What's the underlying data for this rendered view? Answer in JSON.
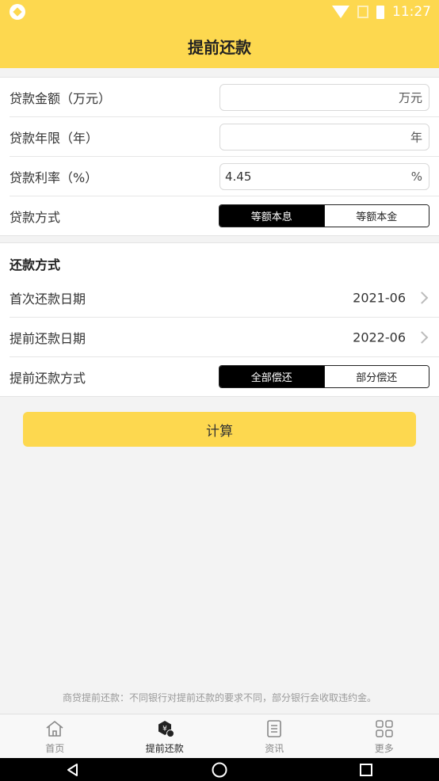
{
  "status": {
    "time": "11:27"
  },
  "header": {
    "title": "提前还款"
  },
  "loan": {
    "amount_label": "贷款金额（万元）",
    "amount_value": "",
    "amount_unit": "万元",
    "years_label": "贷款年限（年）",
    "years_value": "",
    "years_unit": "年",
    "rate_label": "贷款利率（%）",
    "rate_value": "4.45",
    "rate_unit": "%",
    "method_label": "贷款方式",
    "method_options": [
      "等额本息",
      "等额本金"
    ],
    "method_selected": "等额本息"
  },
  "repay": {
    "section_title": "还款方式",
    "first_date_label": "首次还款日期",
    "first_date_value": "2021-06",
    "prepay_date_label": "提前还款日期",
    "prepay_date_value": "2022-06",
    "prepay_method_label": "提前还款方式",
    "prepay_method_options": [
      "全部偿还",
      "部分偿还"
    ],
    "prepay_method_selected": "全部偿还"
  },
  "calculate_label": "计算",
  "footer_note": "商贷提前还款：不同银行对提前还款的要求不同，部分银行会收取违约金。",
  "tabs": [
    {
      "label": "首页",
      "icon": "home-icon",
      "active": false
    },
    {
      "label": "提前还款",
      "icon": "prepay-icon",
      "active": true
    },
    {
      "label": "资讯",
      "icon": "news-icon",
      "active": false
    },
    {
      "label": "更多",
      "icon": "grid-icon",
      "active": false
    }
  ],
  "colors": {
    "accent": "#fdd84f",
    "selected_segment": "#000000"
  }
}
